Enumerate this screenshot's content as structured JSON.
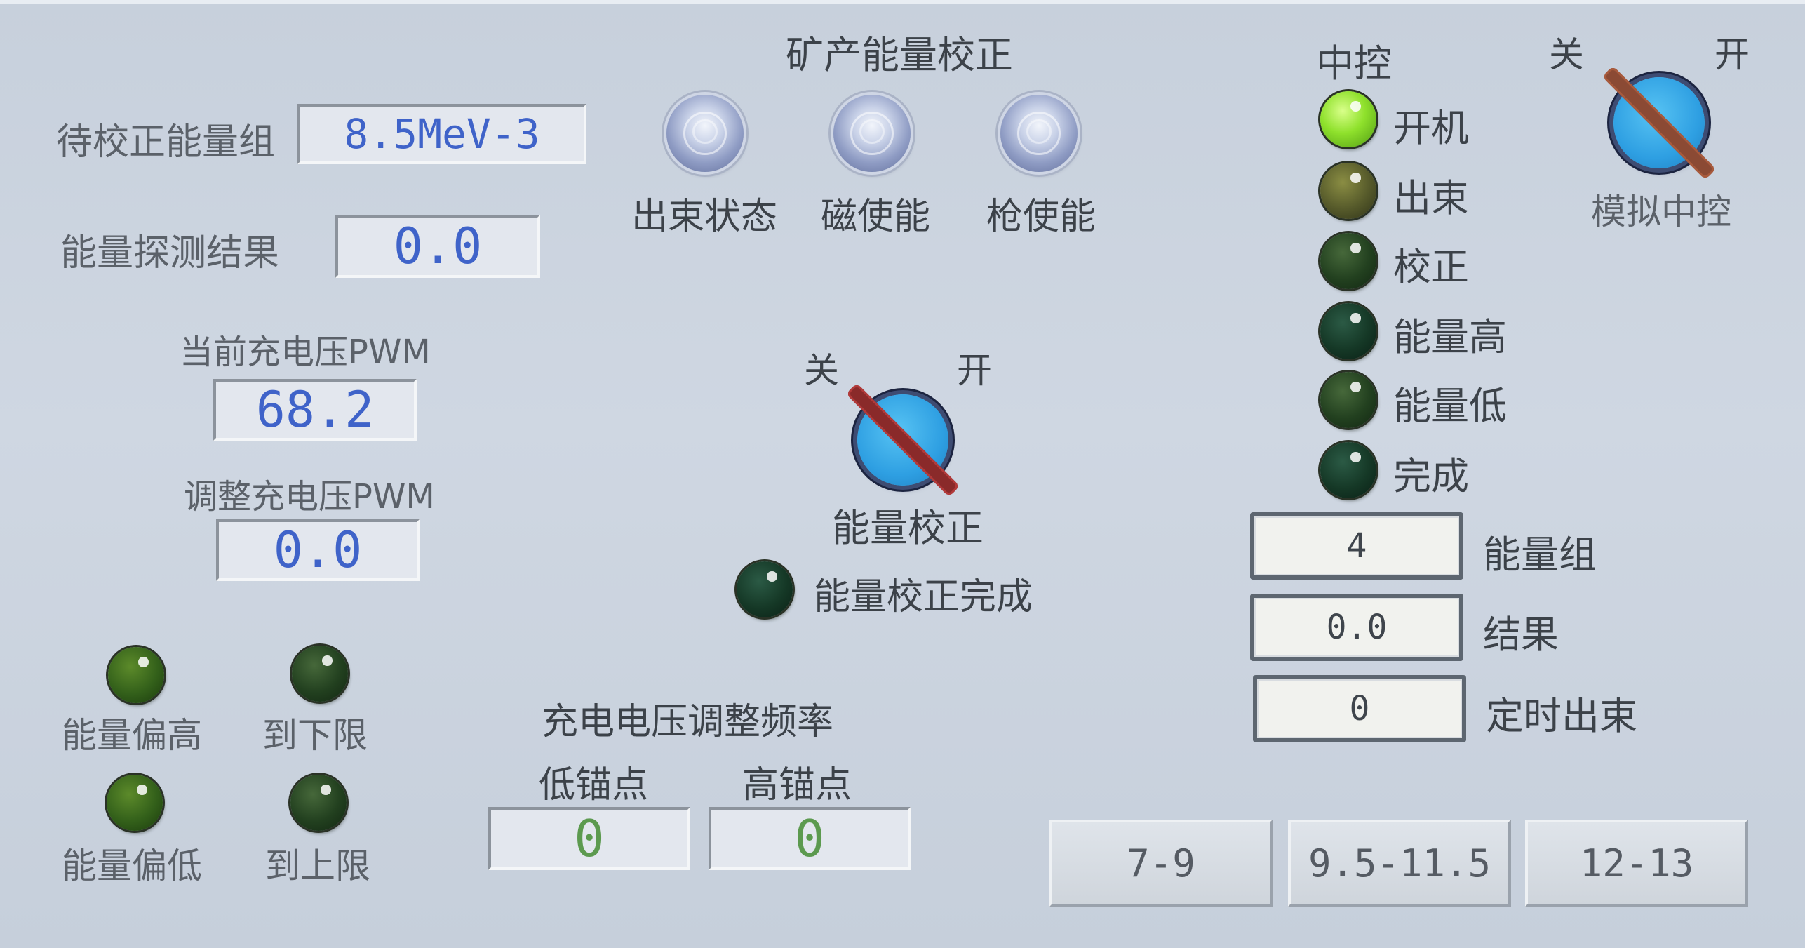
{
  "calibration": {
    "title": "矿产能量校正",
    "pending_group_label": "待校正能量组",
    "pending_group_value": "8.5MeV-3",
    "detect_result_label": "能量探测结果",
    "detect_result_value": "0.0",
    "current_pwm_label": "当前充电压PWM",
    "current_pwm_value": "68.2",
    "adjust_pwm_label": "调整充电压PWM",
    "adjust_pwm_value": "0.0"
  },
  "status_buttons": [
    {
      "label": "出束状态"
    },
    {
      "label": "磁使能"
    },
    {
      "label": "枪使能"
    }
  ],
  "center_switch": {
    "off_label": "关",
    "on_label": "开",
    "label": "能量校正",
    "done_label": "能量校正完成"
  },
  "limits": [
    {
      "label": "能量偏高"
    },
    {
      "label": "到下限"
    },
    {
      "label": "能量偏低"
    },
    {
      "label": "到上限"
    }
  ],
  "freq": {
    "title": "充电电压调整频率",
    "low_label": "低锚点",
    "low_value": "0",
    "high_label": "高锚点",
    "high_value": "0"
  },
  "central": {
    "title": "中控",
    "off_label": "关",
    "on_label": "开",
    "switch_label": "模拟中控",
    "lamps": [
      {
        "label": "开机",
        "state": "on"
      },
      {
        "label": "出束",
        "state": "off"
      },
      {
        "label": "校正",
        "state": "off"
      },
      {
        "label": "能量高",
        "state": "off"
      },
      {
        "label": "能量低",
        "state": "off"
      },
      {
        "label": "完成",
        "state": "off"
      }
    ],
    "energy_group_value": "4",
    "energy_group_label": "能量组",
    "result_value": "0.0",
    "result_label": "结果",
    "timed_beam_value": "0",
    "timed_beam_label": "定时出束"
  },
  "range_buttons": [
    {
      "label": "7-9"
    },
    {
      "label": "9.5-11.5"
    },
    {
      "label": "12-13"
    }
  ]
}
